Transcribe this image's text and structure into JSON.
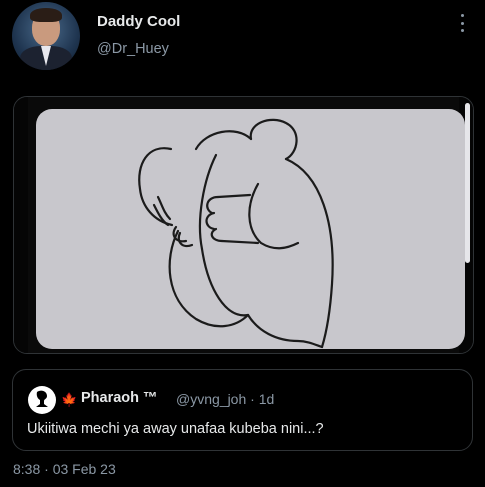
{
  "author": {
    "display_name": "Daddy Cool",
    "handle": "@Dr_Huey"
  },
  "menu_icon": "more-vertical-icon",
  "media": {
    "kind": "image",
    "subject": "line-drawing-hug-illustration"
  },
  "quoted_tweet": {
    "flag": "🍁",
    "display_name": "Pharaoh ™",
    "meta": "@yvng_joh · 1d",
    "text": "Ukiitiwa mechi ya away unafaa kubeba nini...?"
  },
  "timestamp": "8:38 · 03 Feb 23",
  "colors": {
    "background": "#000000",
    "text_primary": "#e7e9ea",
    "text_secondary": "#8b98a5",
    "border": "#2f3336",
    "flag": "#e0245e"
  }
}
